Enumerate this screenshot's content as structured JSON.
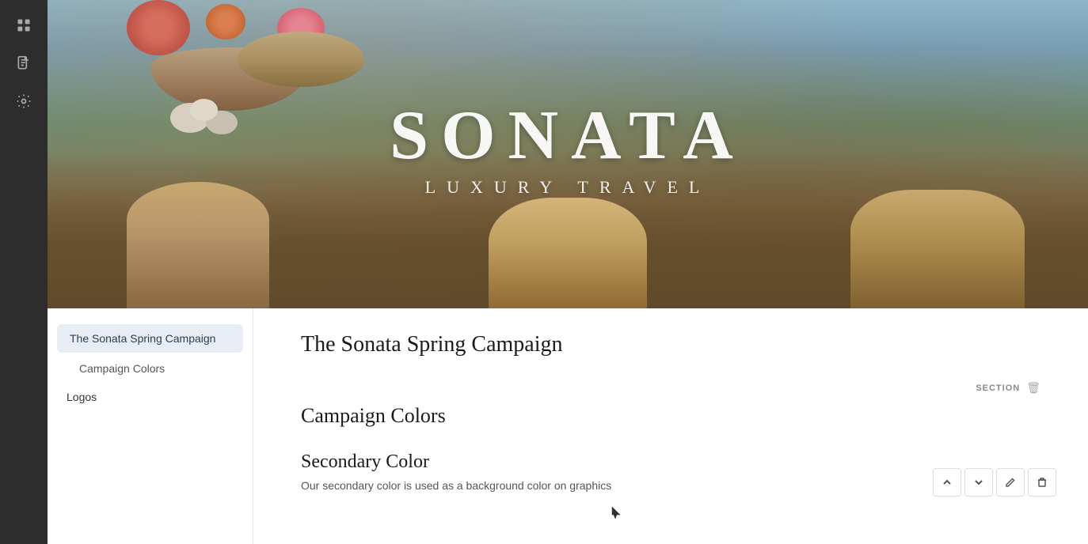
{
  "sidebar": {
    "icons": [
      {
        "name": "grid-icon",
        "symbol": "⊞"
      },
      {
        "name": "document-icon",
        "symbol": "📋"
      },
      {
        "name": "settings-icon",
        "symbol": "⚙"
      }
    ]
  },
  "hero": {
    "brand_title": "SONATA",
    "brand_subtitle": "LUXURY TRAVEL"
  },
  "toc": {
    "active_item": "The Sonata Spring Campaign",
    "sub_items": [
      {
        "label": "Campaign Colors"
      }
    ],
    "group_items": [
      {
        "label": "Logos"
      }
    ]
  },
  "document": {
    "title": "The Sonata Spring Campaign",
    "section_label": "SECTION",
    "section_title": "Campaign Colors",
    "secondary_color_title": "Secondary Color",
    "secondary_color_desc": "Our secondary color is used as a background color on graphics",
    "delete_icon": "🗑",
    "actions": {
      "up_label": "▲",
      "down_label": "▼",
      "edit_label": "✏",
      "delete_label": "🗑"
    }
  }
}
